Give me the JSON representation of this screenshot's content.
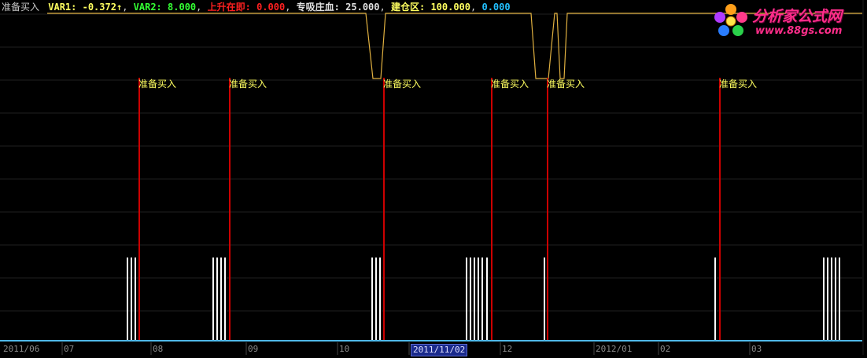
{
  "legend": {
    "title": "准备买入",
    "var1_label": "VAR1:",
    "var1_value": "-0.372↑",
    "var2_label": "VAR2:",
    "var2_value": "8.000",
    "rise_label": "上升在即:",
    "rise_value": "0.000",
    "suck_label": "专吸庄血:",
    "suck_value": "25.000",
    "build_label": "建仓区:",
    "build_value": "100.000",
    "extra_value": "0.000"
  },
  "logo": {
    "title": "分析家公式网",
    "url": "www.88gs.com"
  },
  "signal_label": "准备买入",
  "x_axis": {
    "labels": [
      "2011/06",
      "07",
      "08",
      "09",
      "10",
      "12",
      "2012/01",
      "02",
      "03"
    ],
    "selected_date": "2011/11/02"
  },
  "colors": {
    "background": "#000000",
    "grid": "#202020",
    "signal": "#cc0000",
    "bar": "#ffffff",
    "var_line": "#e0b040",
    "baseline": "#4fb8e8",
    "label_yellow": "#ffff60",
    "var2_green": "#33ff33",
    "rise_red": "#ff2020",
    "build_cyan": "#22c0ff"
  }
}
